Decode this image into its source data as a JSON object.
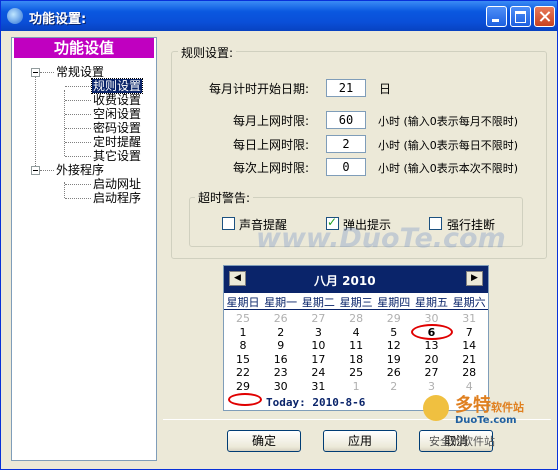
{
  "window": {
    "title": "功能设置:"
  },
  "tree": {
    "header": "功能设值",
    "groups": [
      {
        "label": "常规设置",
        "children": [
          "规则设置",
          "收费设置",
          "空闲设置",
          "密码设置",
          "定时提醒",
          "其它设置"
        ]
      },
      {
        "label": "外接程序",
        "children": [
          "启动网址",
          "启动程序"
        ]
      }
    ],
    "selected": "规则设置"
  },
  "rules": {
    "group_title": "规则设置:",
    "start_day_label": "每月计时开始日期:",
    "start_day_value": "21",
    "start_day_unit": "日",
    "monthly_label": "每月上网时限:",
    "monthly_value": "60",
    "monthly_hint": "小时 (输入0表示每月不限时)",
    "daily_label": "每日上网时限:",
    "daily_value": "2",
    "daily_hint": "小时 (输入0表示每日不限时)",
    "session_label": "每次上网时限:",
    "session_value": "0",
    "session_hint": "小时 (输入0表示本次不限时)"
  },
  "alert": {
    "title": "超时警告:",
    "options": [
      {
        "label": "声音提醒",
        "checked": false
      },
      {
        "label": "弹出提示",
        "checked": true
      },
      {
        "label": "强行挂断",
        "checked": false
      }
    ]
  },
  "calendar": {
    "month_title": "八月 2010",
    "weekdays": [
      "星期日",
      "星期一",
      "星期二",
      "星期三",
      "星期四",
      "星期五",
      "星期六"
    ],
    "weeks": [
      [
        "25",
        "26",
        "27",
        "28",
        "29",
        "30",
        "31"
      ],
      [
        "1",
        "2",
        "3",
        "4",
        "5",
        "6",
        "7"
      ],
      [
        "8",
        "9",
        "10",
        "11",
        "12",
        "13",
        "14"
      ],
      [
        "15",
        "16",
        "17",
        "18",
        "19",
        "20",
        "21"
      ],
      [
        "22",
        "23",
        "24",
        "25",
        "26",
        "27",
        "28"
      ],
      [
        "29",
        "30",
        "31",
        "1",
        "2",
        "3",
        "4"
      ]
    ],
    "selected_day": "6",
    "today_text": "Today: 2010-8-6"
  },
  "buttons": {
    "ok": "确定",
    "apply": "应用",
    "cancel": "取消"
  },
  "watermark": {
    "text": "www.DuoTe.com",
    "site1": "多特",
    "site1b": "软件站",
    "site2": "DuoTe.com",
    "site3": "安全的软件站"
  }
}
